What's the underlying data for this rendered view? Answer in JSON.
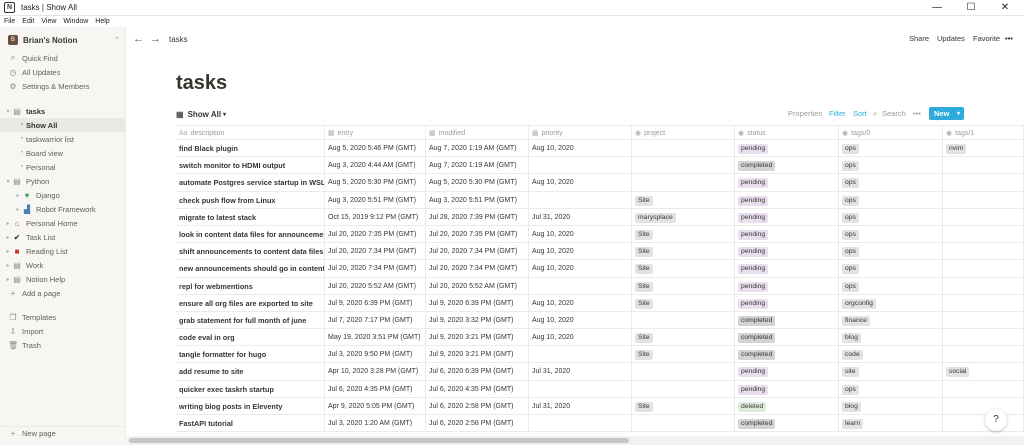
{
  "window": {
    "title": "tasks | Show All",
    "controls": {
      "minimize": "—",
      "maximize": "☐",
      "close": "✕"
    }
  },
  "menubar": [
    "File",
    "Edit",
    "View",
    "Window",
    "Help"
  ],
  "sidebar": {
    "workspace": "Brian's Notion",
    "actions": [
      {
        "label": "Quick Find",
        "icon": "search-icon"
      },
      {
        "label": "All Updates",
        "icon": "clock-icon"
      },
      {
        "label": "Settings & Members",
        "icon": "gear-icon"
      }
    ],
    "pages": [
      {
        "label": "tasks",
        "level": 0,
        "icon": "page-icon"
      },
      {
        "label": "Show All",
        "level": 1,
        "active": true
      },
      {
        "label": "taskwarrior list",
        "level": 1
      },
      {
        "label": "Board view",
        "level": 1
      },
      {
        "label": "Personal",
        "level": 1
      },
      {
        "label": "Python",
        "level": 0,
        "icon": "page-icon"
      },
      {
        "label": "Django",
        "level": 1,
        "icon": "heart-icon"
      },
      {
        "label": "Robot Framework",
        "level": 1,
        "icon": "building-icon"
      },
      {
        "label": "Personal Home",
        "level": 0,
        "icon": "house-icon"
      },
      {
        "label": "Task List",
        "level": 0,
        "icon": "checkmark-icon"
      },
      {
        "label": "Reading List",
        "level": 0,
        "icon": "book-icon"
      },
      {
        "label": "Work",
        "level": 0,
        "icon": "page-icon"
      },
      {
        "label": "Notion Help",
        "level": 0,
        "icon": "page-icon"
      }
    ],
    "add_page": "Add a page",
    "bottom": [
      {
        "label": "Templates",
        "icon": "templates-icon"
      },
      {
        "label": "Import",
        "icon": "import-icon"
      },
      {
        "label": "Trash",
        "icon": "trash-icon"
      }
    ],
    "new_page": "New page"
  },
  "topbar": {
    "breadcrumb": "tasks",
    "share": "Share",
    "updates": "Updates",
    "favorite": "Favorite",
    "more": "•••"
  },
  "page": {
    "title": "tasks"
  },
  "viewbar": {
    "view_name": "Show All",
    "properties": "Properties",
    "filter": "Filter",
    "sort": "Sort",
    "search": "Search",
    "more": "•••",
    "new": "New"
  },
  "colors": {
    "accent": "#2eaadc",
    "pending": "#e8deee",
    "completed": "#d3d3d3",
    "deleted": "#dbeddb"
  },
  "table": {
    "columns": [
      {
        "label": "description",
        "icon": "Aa"
      },
      {
        "label": "entry",
        "icon": "▦"
      },
      {
        "label": "modified",
        "icon": "▦"
      },
      {
        "label": "priority",
        "icon": "▦"
      },
      {
        "label": "project",
        "icon": "◉"
      },
      {
        "label": "status",
        "icon": "◉"
      },
      {
        "label": "tags/0",
        "icon": "◉"
      },
      {
        "label": "tags/1",
        "icon": "◉"
      }
    ],
    "rows": [
      {
        "description": "find Black plugin",
        "entry": "Aug 5, 2020 5:46 PM (GMT)",
        "modified": "Aug 7, 2020 1:19 AM (GMT)",
        "priority": "Aug 10, 2020",
        "project": "",
        "status": "pending",
        "tag0": "ops",
        "tag1": "nvim"
      },
      {
        "description": "switch monitor to HDMI output",
        "entry": "Aug 3, 2020 4:44 AM (GMT)",
        "modified": "Aug 7, 2020 1:19 AM (GMT)",
        "priority": "",
        "project": "",
        "status": "completed",
        "tag0": "ops",
        "tag1": ""
      },
      {
        "description": "automate Postgres service startup in WSL",
        "entry": "Aug 5, 2020 5:30 PM (GMT)",
        "modified": "Aug 5, 2020 5:30 PM (GMT)",
        "priority": "Aug 10, 2020",
        "project": "",
        "status": "pending",
        "tag0": "ops",
        "tag1": ""
      },
      {
        "description": "check push flow from Linux",
        "entry": "Aug 3, 2020 5:51 PM (GMT)",
        "modified": "Aug 3, 2020 5:51 PM (GMT)",
        "priority": "",
        "project": "Site",
        "status": "pending",
        "tag0": "ops",
        "tag1": ""
      },
      {
        "description": "migrate to latest stack",
        "entry": "Oct 15, 2019 9:12 PM (GMT)",
        "modified": "Jul 28, 2020 7:39 PM (GMT)",
        "priority": "Jul 31, 2020",
        "project": "marysplace",
        "status": "pending",
        "tag0": "ops",
        "tag1": ""
      },
      {
        "description": "look in content data files for announcemen",
        "entry": "Jul 20, 2020 7:35 PM (GMT)",
        "modified": "Jul 20, 2020 7:35 PM (GMT)",
        "priority": "Aug 10, 2020",
        "project": "Site",
        "status": "pending",
        "tag0": "ops",
        "tag1": ""
      },
      {
        "description": "shift announcements to content data files",
        "entry": "Jul 20, 2020 7:34 PM (GMT)",
        "modified": "Jul 20, 2020 7:34 PM (GMT)",
        "priority": "Aug 10, 2020",
        "project": "Site",
        "status": "pending",
        "tag0": "ops",
        "tag1": ""
      },
      {
        "description": "new announcements should go in content",
        "entry": "Jul 20, 2020 7:34 PM (GMT)",
        "modified": "Jul 20, 2020 7:34 PM (GMT)",
        "priority": "Aug 10, 2020",
        "project": "Site",
        "status": "pending",
        "tag0": "ops",
        "tag1": ""
      },
      {
        "description": "repl for webmentions",
        "entry": "Jul 20, 2020 5:52 AM (GMT)",
        "modified": "Jul 20, 2020 5:52 AM (GMT)",
        "priority": "",
        "project": "Site",
        "status": "pending",
        "tag0": "ops",
        "tag1": ""
      },
      {
        "description": "ensure all org files are exported to site",
        "entry": "Jul 9, 2020 6:39 PM (GMT)",
        "modified": "Jul 9, 2020 6:39 PM (GMT)",
        "priority": "Aug 10, 2020",
        "project": "Site",
        "status": "pending",
        "tag0": "orgconfig",
        "tag1": ""
      },
      {
        "description": "grab statement for full month of june",
        "entry": "Jul 7, 2020 7:17 PM (GMT)",
        "modified": "Jul 9, 2020 3:32 PM (GMT)",
        "priority": "Aug 10, 2020",
        "project": "",
        "status": "completed",
        "tag0": "finance",
        "tag1": ""
      },
      {
        "description": "code eval in org",
        "entry": "May 19, 2020 3:51 PM (GMT)",
        "modified": "Jul 9, 2020 3:21 PM (GMT)",
        "priority": "Aug 10, 2020",
        "project": "Site",
        "status": "completed",
        "tag0": "blog",
        "tag1": ""
      },
      {
        "description": "tangle formatter for hugo",
        "entry": "Jul 3, 2020 9:50 PM (GMT)",
        "modified": "Jul 9, 2020 3:21 PM (GMT)",
        "priority": "",
        "project": "Site",
        "status": "completed",
        "tag0": "code",
        "tag1": ""
      },
      {
        "description": "add resume to site",
        "entry": "Apr 10, 2020 3:28 PM (GMT)",
        "modified": "Jul 6, 2020 6:39 PM (GMT)",
        "priority": "Jul 31, 2020",
        "project": "",
        "status": "pending",
        "tag0": "site",
        "tag1": "social"
      },
      {
        "description": "quicker exec taskrh startup",
        "entry": "Jul 6, 2020 4:35 PM (GMT)",
        "modified": "Jul 6, 2020 4:35 PM (GMT)",
        "priority": "",
        "project": "",
        "status": "pending",
        "tag0": "ops",
        "tag1": ""
      },
      {
        "description": "writing blog posts in Eleventy",
        "entry": "Apr 9, 2020 5:05 PM (GMT)",
        "modified": "Jul 6, 2020 2:58 PM (GMT)",
        "priority": "Jul 31, 2020",
        "project": "Site",
        "status": "deleted",
        "tag0": "blog",
        "tag1": ""
      },
      {
        "description": "FastAPI tutorial",
        "entry": "Jul 3, 2020 1:20 AM (GMT)",
        "modified": "Jul 6, 2020 2:58 PM (GMT)",
        "priority": "",
        "project": "",
        "status": "completed",
        "tag0": "learn",
        "tag1": ""
      }
    ]
  },
  "help": "?"
}
